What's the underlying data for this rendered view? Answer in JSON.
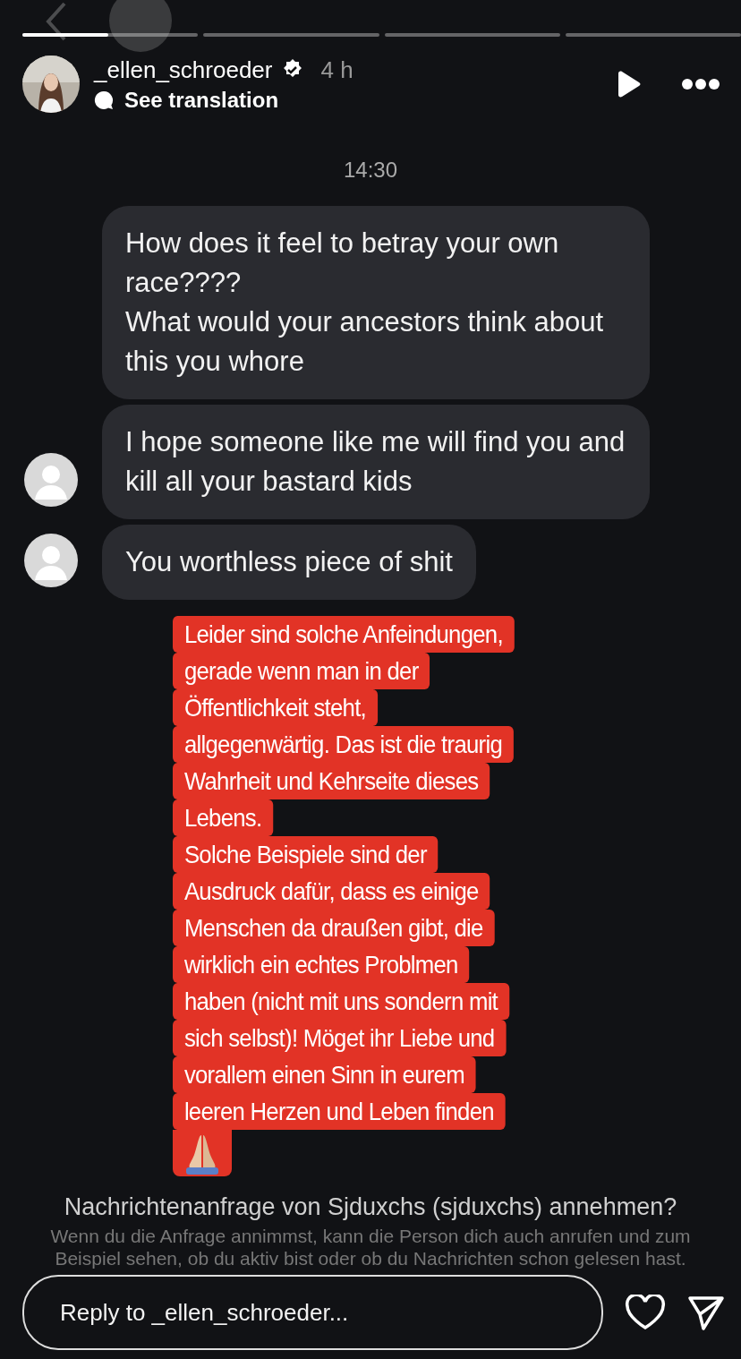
{
  "story_progress": [
    {
      "level": 0.49
    },
    {
      "level": 0
    },
    {
      "level": 0
    },
    {
      "level": 0
    }
  ],
  "author": {
    "username": "_ellen_schroeder",
    "verified": true,
    "time": "4 h",
    "translation": "See translation"
  },
  "chat": {
    "timestamp": "14:30",
    "messages": [
      {
        "lines": [
          "How does it feel to betray your own race????",
          "What would your ancestors think about this you whore"
        ],
        "avatar": false
      },
      {
        "lines": [
          "I hope someone like me will find you and kill all your bastard kids"
        ],
        "avatar": true
      },
      {
        "lines": [
          "You worthless piece of shit"
        ],
        "avatar": true
      }
    ]
  },
  "note": {
    "lines": [
      "Leider sind solche Anfeindungen,",
      "gerade wenn man in der",
      "Öffentlichkeit steht,",
      "allgegenwärtig. Das ist die traurig",
      "Wahrheit und Kehrseite dieses",
      "Lebens.",
      "Solche Beispiele sind der",
      "Ausdruck dafür, dass es einige",
      "Menschen da draußen gibt, die",
      "wirklich ein echtes Problmen",
      "haben (nicht mit uns sondern mit",
      "sich selbst)! Möget ihr Liebe und",
      "vorallem einen Sinn in eurem",
      "leeren Herzen und Leben finden"
    ]
  },
  "request": {
    "question": "Nachrichtenanfrage von Sjduxchs (sjduxchs) annehmen?",
    "detail": "Wenn du die Anfrage annimmst, kann die Person dich auch anrufen und zum Beispiel sehen, ob du aktiv bist oder ob du Nachrichten schon gelesen hast."
  },
  "reply": {
    "placeholder": "Reply to _ellen_schroeder..."
  }
}
